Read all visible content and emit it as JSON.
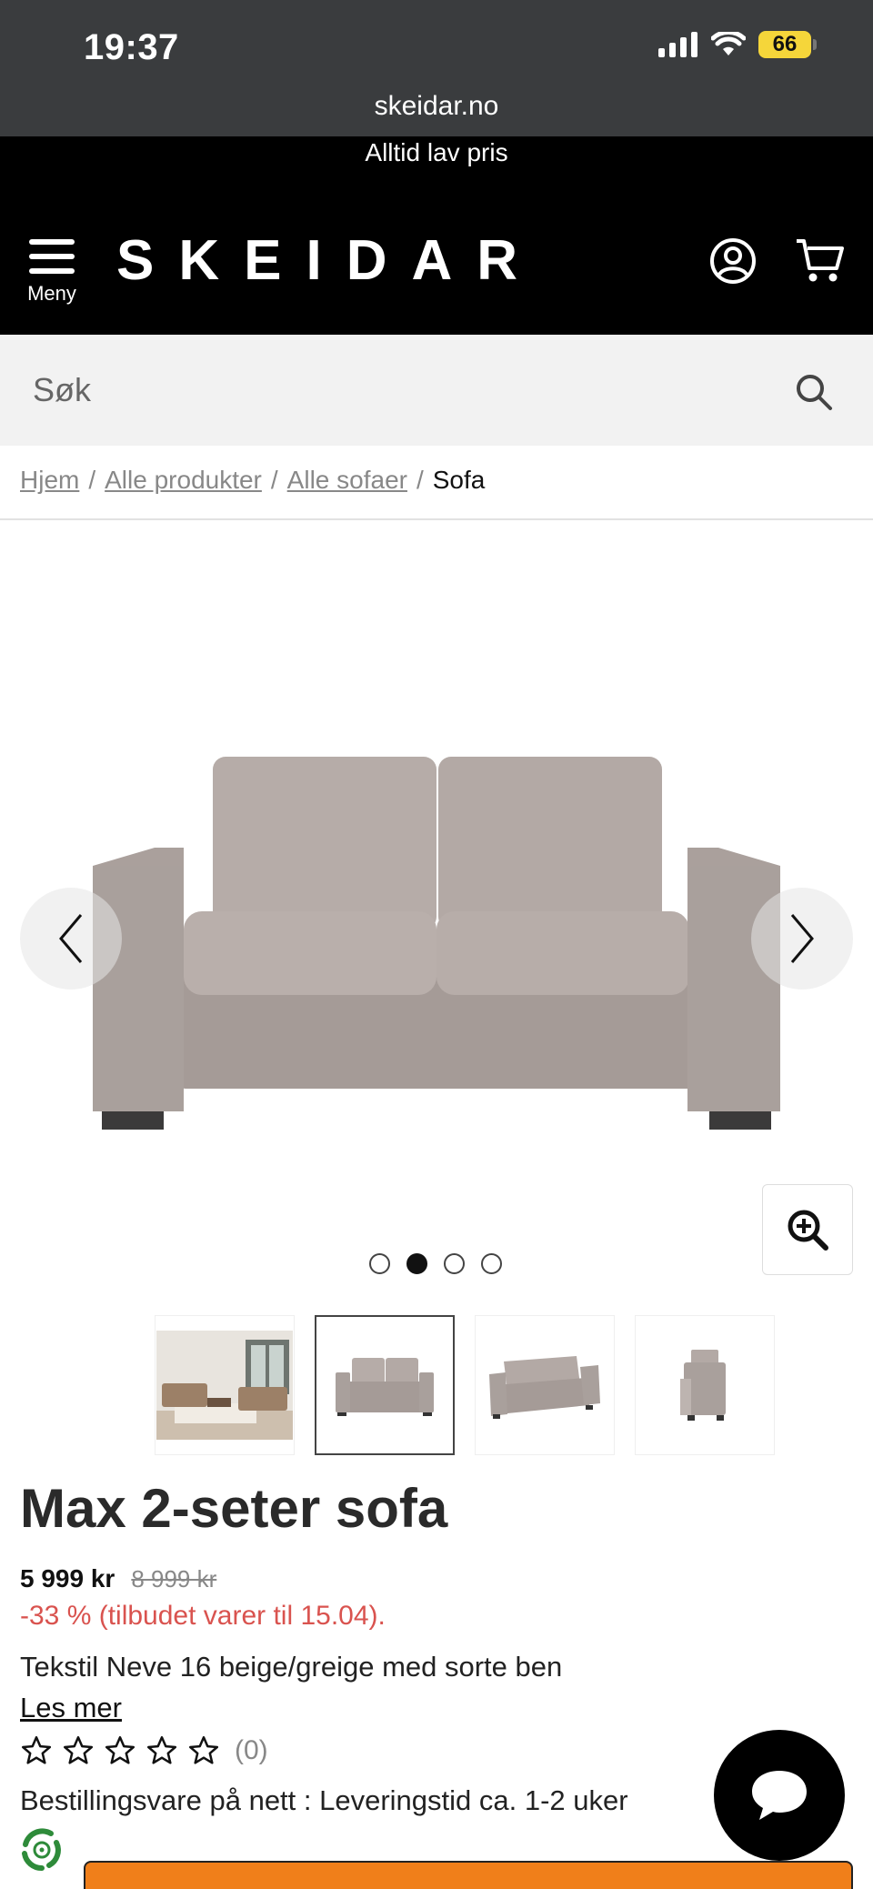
{
  "status_bar": {
    "time": "19:37",
    "battery": "66"
  },
  "browser": {
    "url": "skeidar.no"
  },
  "promo": {
    "text": "Alltid lav pris"
  },
  "header": {
    "menu_label": "Meny",
    "logo": "SKEIDAR"
  },
  "search": {
    "placeholder": "Søk"
  },
  "breadcrumb": {
    "items": [
      "Hjem",
      "Alle produkter",
      "Alle sofaer"
    ],
    "separator": "/",
    "current": "Sofa"
  },
  "gallery": {
    "image_count": 4,
    "active_index": 1
  },
  "product": {
    "title": "Max 2-seter sofa",
    "price": "5 999 kr",
    "old_price": "8 999 kr",
    "discount": "-33 % (tilbudet varer til 15.04).",
    "variant": "Tekstil Neve 16 beige/greige med sorte ben",
    "read_more": "Les mer",
    "rating_count": "(0)",
    "rating_stars": 0,
    "delivery": "Bestillingsvare på nett : Leveringstid ca. 1-2 uker"
  },
  "colors": {
    "header_bg": "#000000",
    "discount": "#d9534f",
    "cta": "#f07f1a"
  }
}
